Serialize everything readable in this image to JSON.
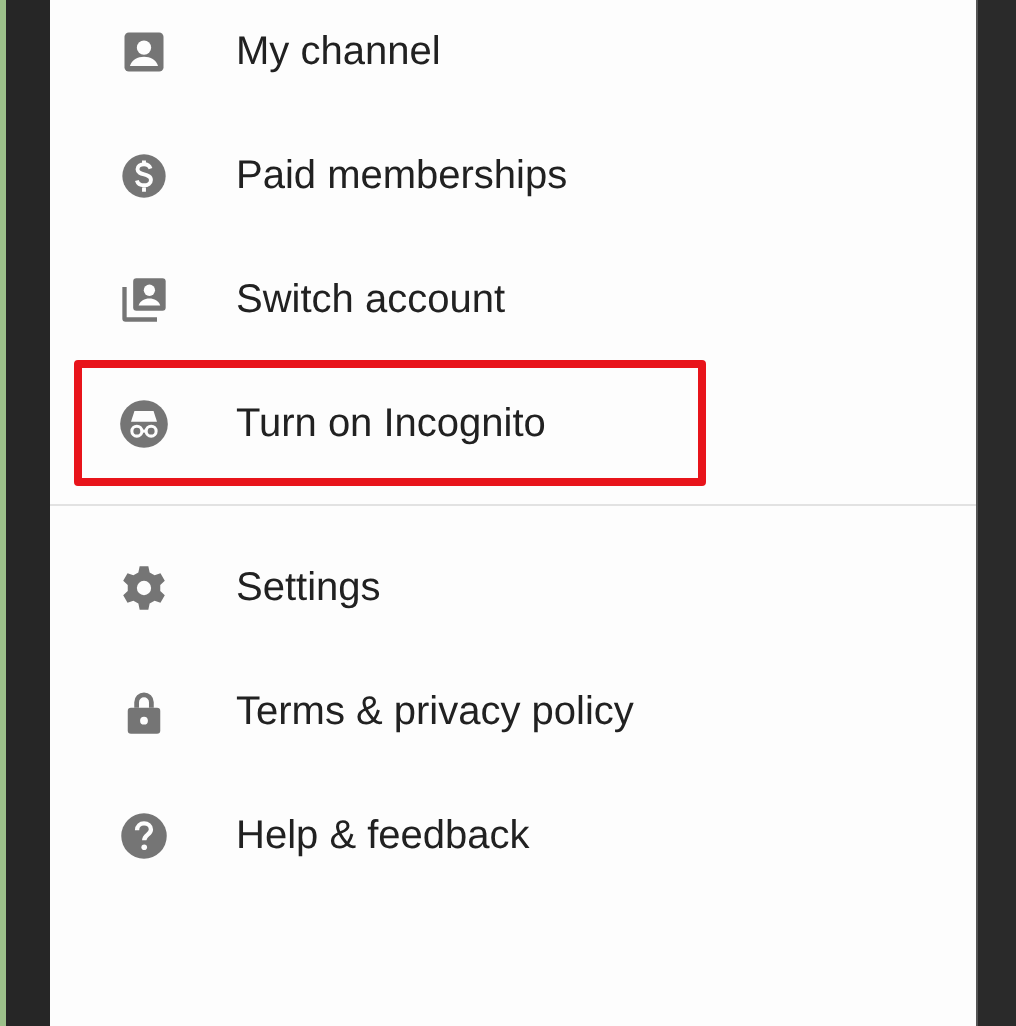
{
  "menu": {
    "groups": [
      {
        "items": [
          {
            "label": "My channel",
            "highlighted": false
          },
          {
            "label": "Paid memberships",
            "highlighted": false
          },
          {
            "label": "Switch account",
            "highlighted": false
          },
          {
            "label": "Turn on Incognito",
            "highlighted": true
          }
        ]
      },
      {
        "items": [
          {
            "label": "Settings",
            "highlighted": false
          },
          {
            "label": "Terms & privacy policy",
            "highlighted": false
          },
          {
            "label": "Help & feedback",
            "highlighted": false
          }
        ]
      }
    ]
  }
}
